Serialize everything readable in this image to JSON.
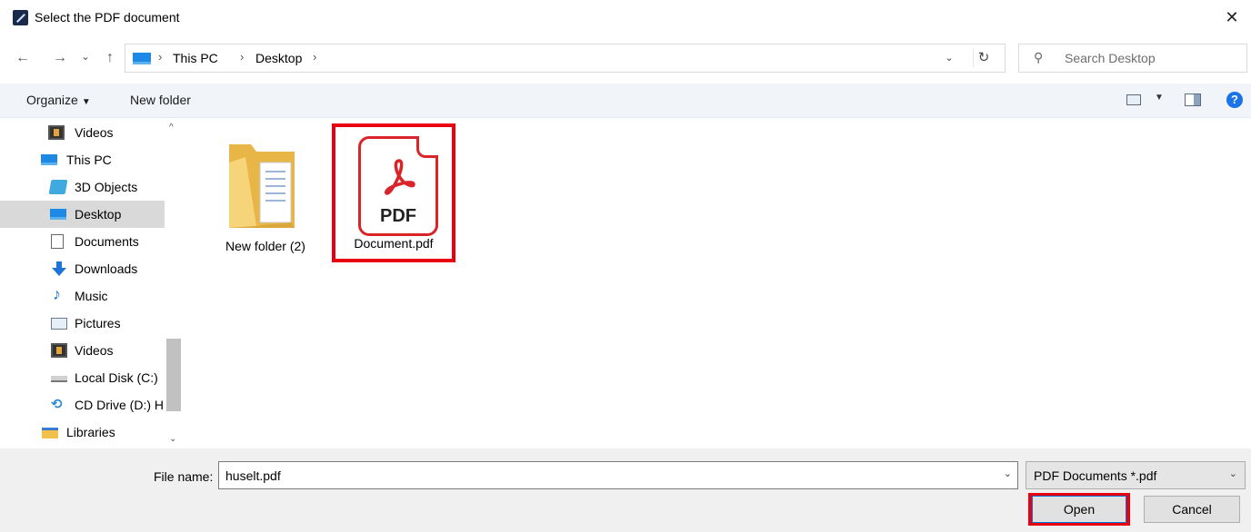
{
  "window": {
    "title": "Select the PDF document",
    "close_glyph": "✕"
  },
  "nav": {
    "back_glyph": "←",
    "forward_glyph": "→",
    "recent_glyph": "⌄",
    "up_glyph": "↑"
  },
  "address": {
    "crumbs": [
      "This PC",
      "Desktop"
    ],
    "separator": "›",
    "dropdown_glyph": "⌄",
    "refresh_glyph": "↻"
  },
  "search": {
    "glyph": "⚲",
    "placeholder": "Search Desktop"
  },
  "toolbar": {
    "organize_label": "Organize",
    "organize_caret": "▼",
    "new_folder_label": "New folder",
    "view_caret": "▼",
    "help_glyph": "?"
  },
  "sidebar": {
    "items": [
      {
        "label": "Videos",
        "icon": "videos-icon"
      },
      {
        "label": "This PC",
        "icon": "this-pc-icon"
      },
      {
        "label": "3D Objects",
        "icon": "3d-objects-icon"
      },
      {
        "label": "Desktop",
        "icon": "desktop-icon",
        "selected": true
      },
      {
        "label": "Documents",
        "icon": "documents-icon"
      },
      {
        "label": "Downloads",
        "icon": "downloads-icon"
      },
      {
        "label": "Music",
        "icon": "music-icon"
      },
      {
        "label": "Pictures",
        "icon": "pictures-icon"
      },
      {
        "label": "Videos",
        "icon": "videos-icon"
      },
      {
        "label": "Local Disk (C:)",
        "icon": "local-disk-icon"
      },
      {
        "label": "CD Drive (D:) H",
        "icon": "cd-drive-icon"
      },
      {
        "label": "Libraries",
        "icon": "libraries-icon"
      }
    ],
    "scroll_up_glyph": "^",
    "scroll_down_glyph": "⌄"
  },
  "files": [
    {
      "name": "New folder (2)",
      "icon": "folder-icon"
    },
    {
      "name": "Document.pdf",
      "icon": "pdf-file-icon",
      "icon_text": "PDF",
      "highlighted": true
    }
  ],
  "bottom": {
    "file_name_label": "File name:",
    "file_name_value": "huselt.pdf",
    "file_name_drop": "⌄",
    "file_type_value": "PDF Documents *.pdf",
    "file_type_drop": "⌄",
    "open_label": "Open",
    "cancel_label": "Cancel"
  },
  "colors": {
    "highlight": "#e8000f",
    "pdf_red": "#d9252a",
    "selection": "#d9d9d9",
    "accent": "#0078d7"
  }
}
